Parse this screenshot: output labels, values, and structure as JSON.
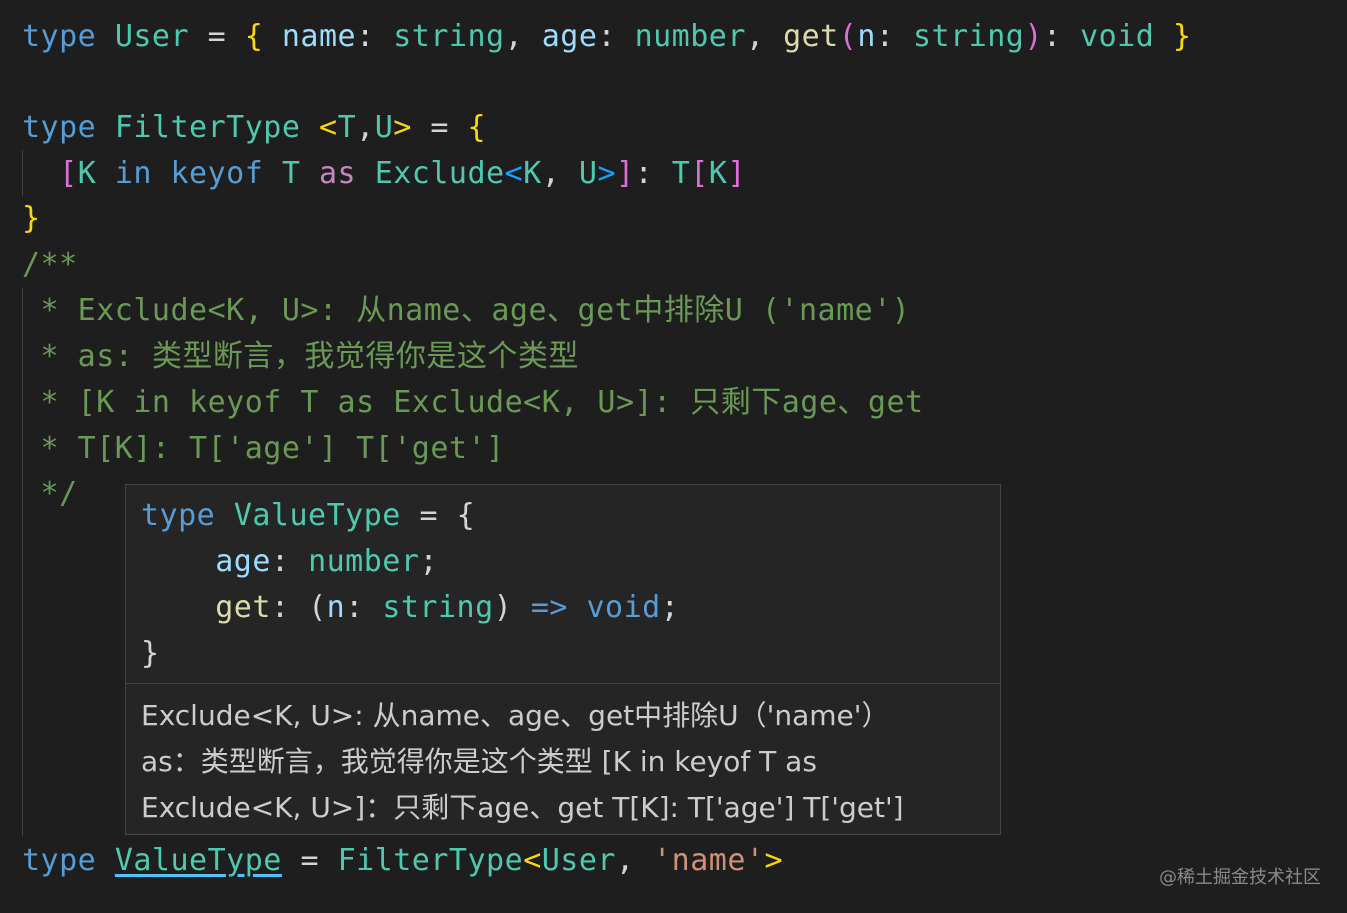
{
  "code": {
    "line1": {
      "kw": "type",
      "name": "User",
      "eq": "=",
      "open": "{",
      "p1": "name",
      "c1": ":",
      "t1": "string",
      "comma1": ",",
      "p2": "age",
      "c2": ":",
      "t2": "number",
      "comma2": ",",
      "p3": "get",
      "po": "(",
      "pa": "n",
      "c3": ":",
      "t3": "string",
      "pc": ")",
      "c4": ":",
      "t4": "void",
      "close": "}"
    },
    "line2": {
      "kw": "type",
      "name": "FilterType",
      "gen_open": "<",
      "g1": "T",
      "gcomma": ",",
      "g2": "U",
      "gen_close": ">",
      "eq": "=",
      "open": "{"
    },
    "line3": {
      "bo": "[",
      "k": "K",
      "in": "in",
      "keyof": "keyof",
      "t": "T",
      "as": "as",
      "ex": "Exclude",
      "lt": "<",
      "k2": "K",
      "comma": ",",
      "u": "U",
      "gt": ">",
      "bc": "]",
      "colon": ":",
      "t2": "T",
      "bo2": "[",
      "k3": "K",
      "bc2": "]"
    },
    "line4": {
      "close": "}"
    },
    "comment": [
      "/**",
      " * Exclude<K, U>: 从name、age、get中排除U ('name')",
      " * as: 类型断言，我觉得你是这个类型",
      " * [K in keyof T as Exclude<K, U>]: 只剩下age、get",
      " * T[K]: T['age'] T['get']",
      " */"
    ],
    "last": {
      "kw": "type",
      "name": "ValueType",
      "eq": "=",
      "ft": "FilterType",
      "lt": "<",
      "u": "User",
      "comma": ",",
      "str": "'name'",
      "gt": ">"
    }
  },
  "hover": {
    "code": {
      "l1_kw": "type",
      "l1_name": "ValueType",
      "l1_eq": "=",
      "l1_open": "{",
      "l2_prop": "age",
      "l2_colon": ":",
      "l2_type": "number",
      "l2_semi": ";",
      "l3_prop": "get",
      "l3_colon": ":",
      "l3_po": "(",
      "l3_pa": "n",
      "l3_c": ":",
      "l3_t": "string",
      "l3_pc": ")",
      "l3_arrow": "=>",
      "l3_void": "void",
      "l3_semi": ";",
      "l4_close": "}"
    },
    "doc": [
      "Exclude<K, U>: 从name、age、get中排除U（'name'）",
      "as：类型断言，我觉得你是这个类型 [K in keyof T as",
      "Exclude<K, U>]：只剩下age、get T[K]: T['age'] T['get']"
    ]
  },
  "watermark": "@稀土掘金技术社区"
}
